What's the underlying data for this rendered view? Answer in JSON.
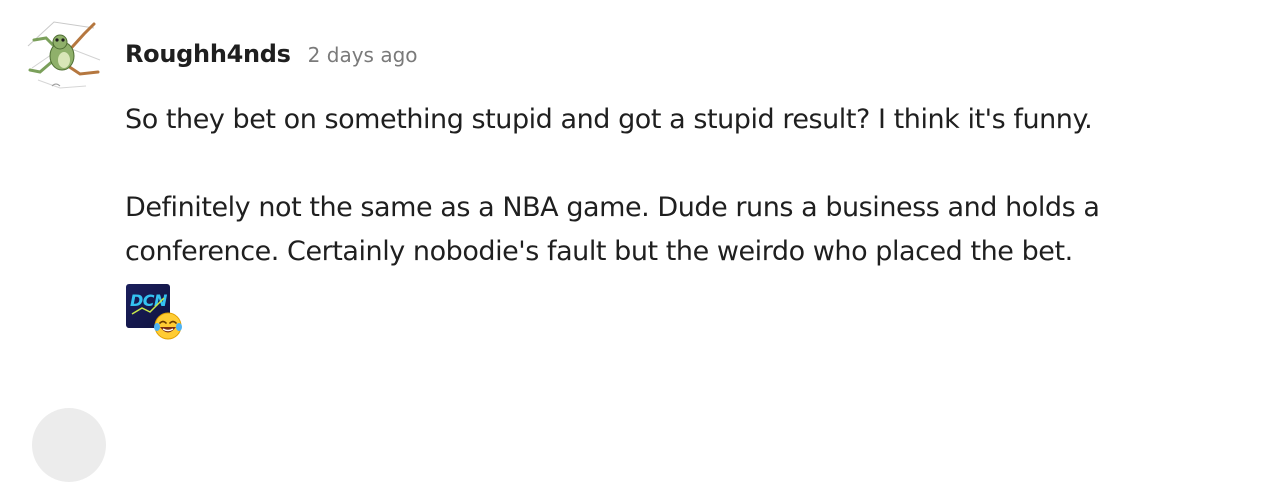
{
  "comment": {
    "author": "Roughh4nds",
    "timestamp": "2 days ago",
    "paragraphs": {
      "first": "So they bet on something stupid and got a stupid result? I think it's funny.",
      "second_line1": "Definitely not the same as a NBA game. Dude runs a business and holds a",
      "second_line2": "conference. Certainly nobodie's fault but the weirdo who placed the bet."
    },
    "avatar_icon": "frog-sketch-avatar",
    "reaction": {
      "logo_text": "DCN",
      "emoji": "face-with-tears-of-joy"
    }
  },
  "colors": {
    "text": "#1f1f1f",
    "timestamp": "#7a7a7a",
    "placeholder_avatar": "#ececec"
  }
}
